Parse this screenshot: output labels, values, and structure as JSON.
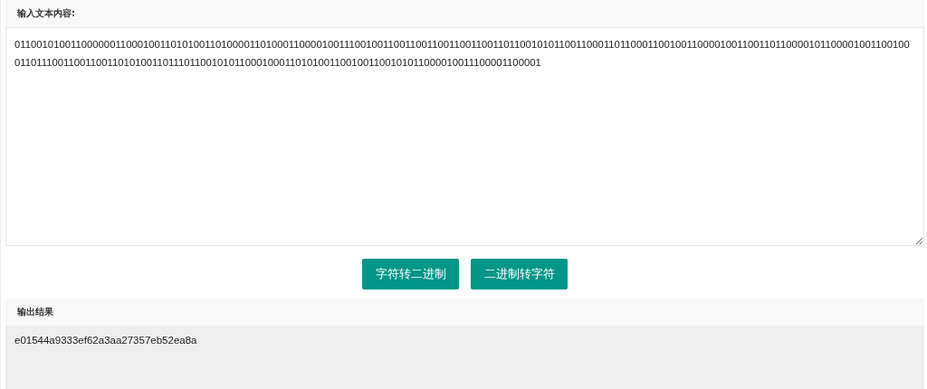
{
  "input_section": {
    "title": "输入文本内容:",
    "value": "0110010100110000001100010011010100110100001101000110000100111001001100110011001100110011011001010110011000110110001100100110000100110011011000010110000100110010001101110011001100110101001101110110010101100010001101010011001001100101011000010011100001100001"
  },
  "buttons": [
    {
      "label": "字符转二进制"
    },
    {
      "label": "二进制转字符"
    }
  ],
  "output_section": {
    "title": "输出结果",
    "value": "e01544a9333ef62a3aa27357eb52ea8a"
  }
}
